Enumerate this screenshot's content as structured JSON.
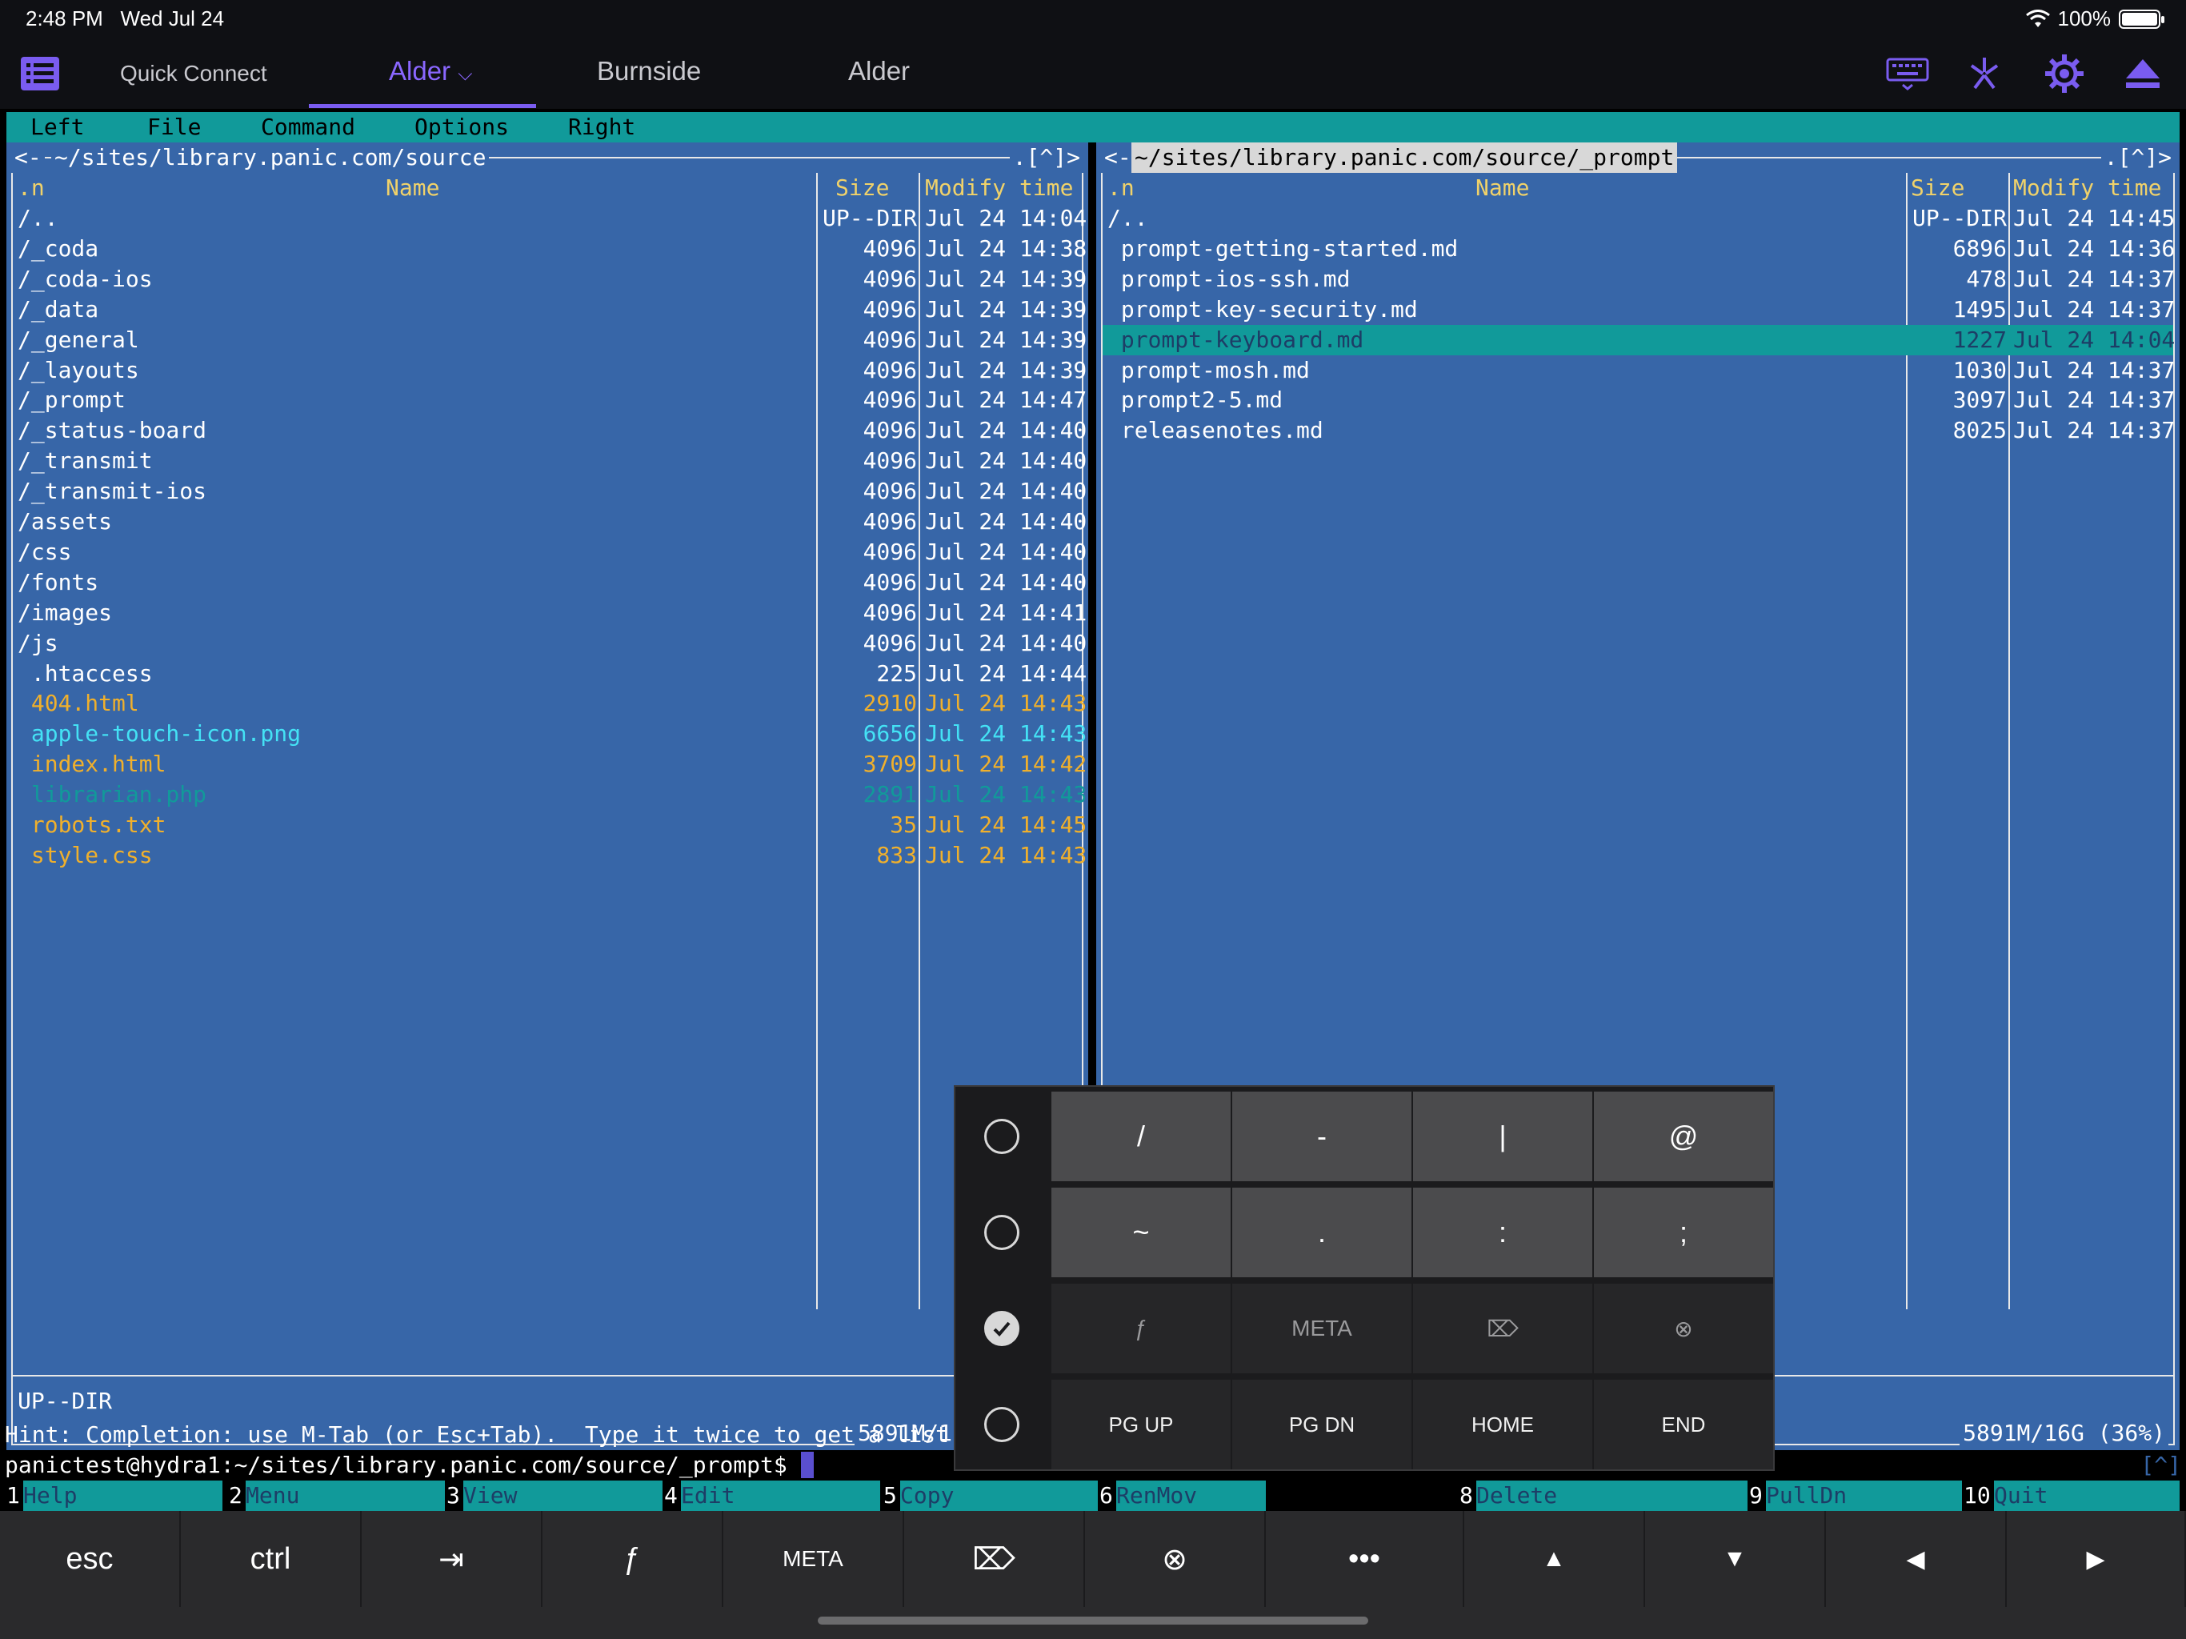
{
  "status": {
    "time": "2:48 PM",
    "date": "Wed Jul 24",
    "battery": "100%",
    "battery_level": 1.0
  },
  "toolbar": {
    "quick_connect": "Quick Connect",
    "tabs": [
      "Alder",
      "Burnside",
      "Alder"
    ],
    "active_tab": "Alder"
  },
  "menubar": [
    "Left",
    "File",
    "Command",
    "Options",
    "Right"
  ],
  "left_panel": {
    "path": "~/sites/library.panic.com/source",
    "corner": ".[^]>",
    "headers": {
      "n": ".n",
      "name": "Name",
      "size": "Size",
      "mtime": "Modify time"
    },
    "rows": [
      {
        "name": "/..",
        "size": "UP--DIR",
        "time": "Jul 24 14:04",
        "color": "white"
      },
      {
        "name": "/_coda",
        "size": "4096",
        "time": "Jul 24 14:38",
        "color": "white"
      },
      {
        "name": "/_coda-ios",
        "size": "4096",
        "time": "Jul 24 14:39",
        "color": "white"
      },
      {
        "name": "/_data",
        "size": "4096",
        "time": "Jul 24 14:39",
        "color": "white"
      },
      {
        "name": "/_general",
        "size": "4096",
        "time": "Jul 24 14:39",
        "color": "white"
      },
      {
        "name": "/_layouts",
        "size": "4096",
        "time": "Jul 24 14:39",
        "color": "white"
      },
      {
        "name": "/_prompt",
        "size": "4096",
        "time": "Jul 24 14:47",
        "color": "white"
      },
      {
        "name": "/_status-board",
        "size": "4096",
        "time": "Jul 24 14:40",
        "color": "white"
      },
      {
        "name": "/_transmit",
        "size": "4096",
        "time": "Jul 24 14:40",
        "color": "white"
      },
      {
        "name": "/_transmit-ios",
        "size": "4096",
        "time": "Jul 24 14:40",
        "color": "white"
      },
      {
        "name": "/assets",
        "size": "4096",
        "time": "Jul 24 14:40",
        "color": "white"
      },
      {
        "name": "/css",
        "size": "4096",
        "time": "Jul 24 14:40",
        "color": "white"
      },
      {
        "name": "/fonts",
        "size": "4096",
        "time": "Jul 24 14:40",
        "color": "white"
      },
      {
        "name": "/images",
        "size": "4096",
        "time": "Jul 24 14:41",
        "color": "white"
      },
      {
        "name": "/js",
        "size": "4096",
        "time": "Jul 24 14:40",
        "color": "white"
      },
      {
        "name": " .htaccess",
        "size": "225",
        "time": "Jul 24 14:44",
        "color": "white"
      },
      {
        "name": " 404.html",
        "size": "2910",
        "time": "Jul 24 14:43",
        "color": "orange"
      },
      {
        "name": " apple-touch-icon.png",
        "size": "6656",
        "time": "Jul 24 14:43",
        "color": "cyan"
      },
      {
        "name": " index.html",
        "size": "3709",
        "time": "Jul 24 14:42",
        "color": "orange"
      },
      {
        "name": " librarian.php",
        "size": "2891",
        "time": "Jul 24 14:43",
        "color": "teal"
      },
      {
        "name": " robots.txt",
        "size": "35",
        "time": "Jul 24 14:45",
        "color": "orange"
      },
      {
        "name": " style.css",
        "size": "833",
        "time": "Jul 24 14:43",
        "color": "orange"
      }
    ],
    "status": "UP--DIR",
    "disk": "5891M/1"
  },
  "right_panel": {
    "path": "~/sites/library.panic.com/source/_prompt",
    "corner": ".[^]>",
    "headers": {
      "n": ".n",
      "name": "Name",
      "size": "Size",
      "mtime": "Modify time"
    },
    "rows": [
      {
        "name": "/..",
        "size": "UP--DIR",
        "time": "Jul 24 14:45",
        "selected": false
      },
      {
        "name": " prompt-getting-started.md",
        "size": "6896",
        "time": "Jul 24 14:36",
        "selected": false
      },
      {
        "name": " prompt-ios-ssh.md",
        "size": "478",
        "time": "Jul 24 14:37",
        "selected": false
      },
      {
        "name": " prompt-key-security.md",
        "size": "1495",
        "time": "Jul 24 14:37",
        "selected": false
      },
      {
        "name": " prompt-keyboard.md",
        "size": "1227",
        "time": "Jul 24 14:04",
        "selected": true
      },
      {
        "name": " prompt-mosh.md",
        "size": "1030",
        "time": "Jul 24 14:37",
        "selected": false
      },
      {
        "name": " prompt2-5.md",
        "size": "3097",
        "time": "Jul 24 14:37",
        "selected": false
      },
      {
        "name": " releasenotes.md",
        "size": "8025",
        "time": "Jul 24 14:37",
        "selected": false
      }
    ],
    "disk": "5891M/16G (36%)"
  },
  "hint": "Hint: Completion: use M-Tab (or Esc+Tab).  Type it twice to get a list.",
  "prompt": "panictest@hydra1:~/sites/library.panic.com/source/_prompt$",
  "prompt_corner": "[^]",
  "fkeys": [
    {
      "n": "1",
      "label": "Help"
    },
    {
      "n": "2",
      "label": "Menu"
    },
    {
      "n": "3",
      "label": "View"
    },
    {
      "n": "4",
      "label": "Edit"
    },
    {
      "n": "5",
      "label": "Copy"
    },
    {
      "n": "6",
      "label": "RenMov"
    },
    {
      "n": "8",
      "label": "Delete"
    },
    {
      "n": "9",
      "label": "PullDn"
    },
    {
      "n": "10",
      "label": "Quit"
    }
  ],
  "popup": {
    "rows": [
      {
        "checked": false,
        "keys": [
          "/",
          "-",
          "|",
          "@"
        ]
      },
      {
        "checked": false,
        "keys": [
          "~",
          ".",
          ":",
          ";"
        ]
      },
      {
        "checked": true,
        "keys": [
          "ƒ",
          "META",
          "⌦",
          "⊗"
        ]
      },
      {
        "checked": false,
        "keys": [
          "PG UP",
          "PG DN",
          "HOME",
          "END"
        ]
      }
    ]
  },
  "bottom_keys": [
    "esc",
    "ctrl",
    "⇥",
    "ƒ",
    "META",
    "⌦",
    "⊗",
    "•••",
    "▲",
    "▼",
    "◀",
    "▶"
  ]
}
